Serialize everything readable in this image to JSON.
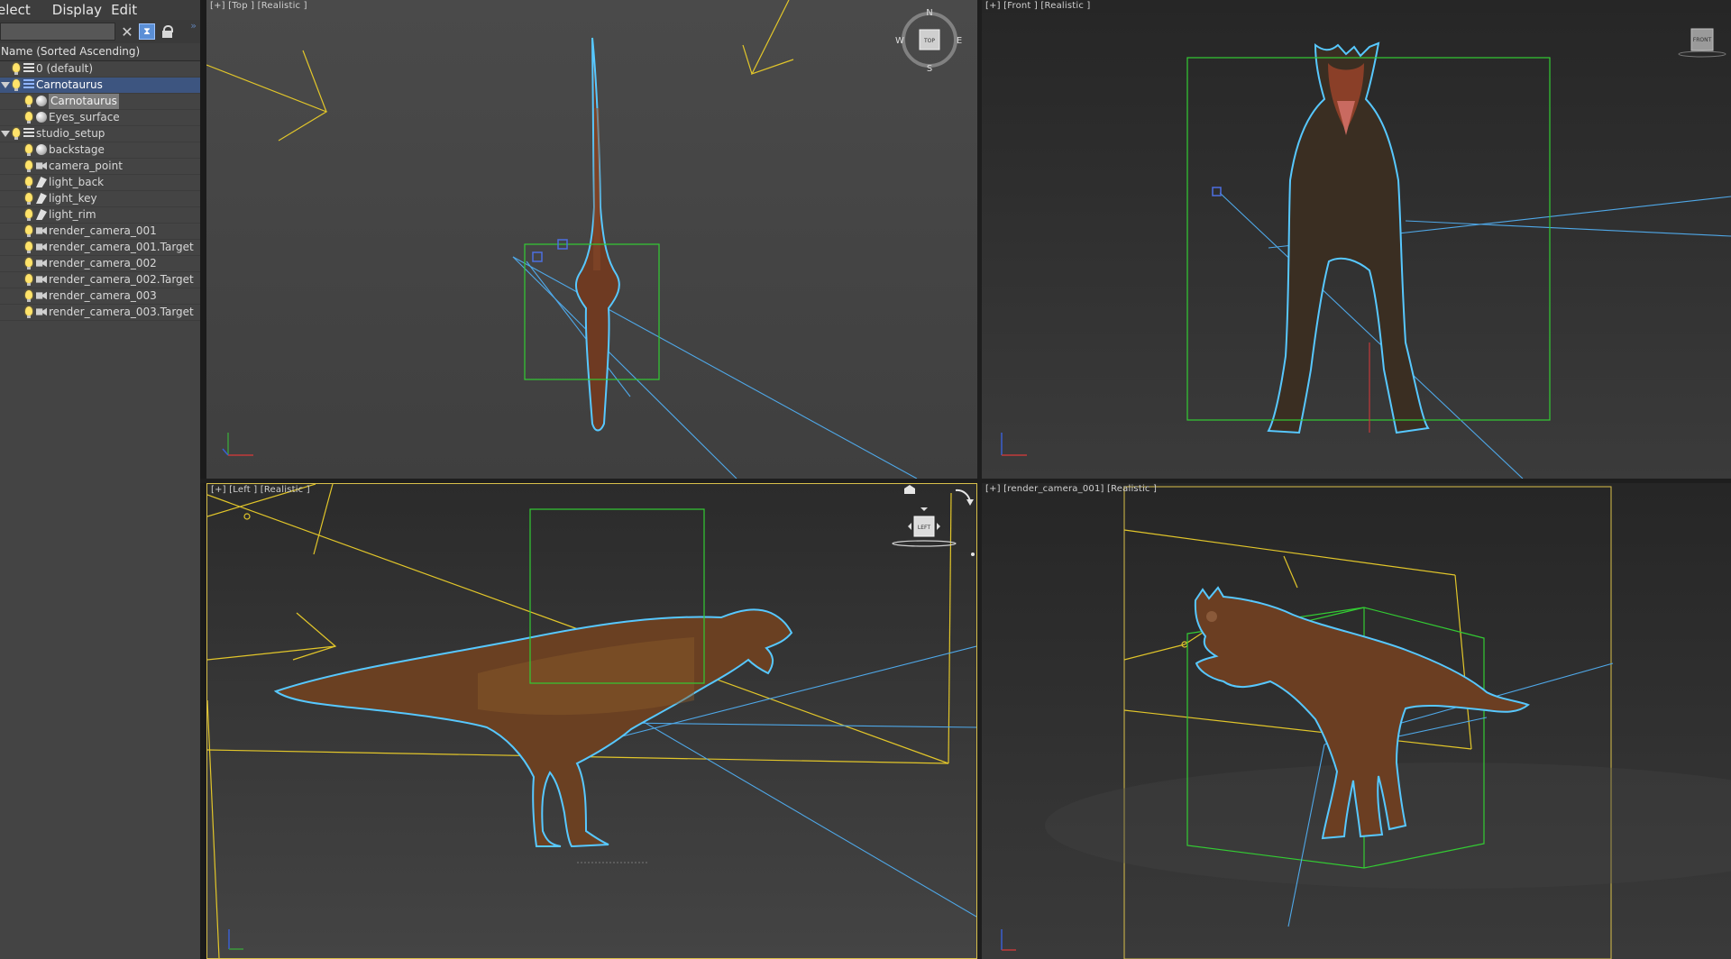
{
  "menu": {
    "select": "elect",
    "display": "Display",
    "edit": "Edit"
  },
  "explorer": {
    "filter_placeholder": "",
    "column_header": "Name (Sorted Ascending)",
    "rows": [
      {
        "label": "0 (default)",
        "depth": 1,
        "icon": "layer-icon"
      },
      {
        "label": "Carnotaurus",
        "depth": 1,
        "icon": "layer-icon"
      },
      {
        "label": "Carnotaurus",
        "depth": 2,
        "icon": "sphere-icon"
      },
      {
        "label": "Eyes_surface",
        "depth": 2,
        "icon": "sphere-icon"
      },
      {
        "label": "studio_setup",
        "depth": 1,
        "icon": "layer-icon"
      },
      {
        "label": "backstage",
        "depth": 2,
        "icon": "sphere-icon"
      },
      {
        "label": "camera_point",
        "depth": 2,
        "icon": "camera-icon"
      },
      {
        "label": "light_back",
        "depth": 2,
        "icon": "light-icon"
      },
      {
        "label": "light_key",
        "depth": 2,
        "icon": "light-icon"
      },
      {
        "label": "light_rim",
        "depth": 2,
        "icon": "light-icon"
      },
      {
        "label": "render_camera_001",
        "depth": 2,
        "icon": "camera-icon"
      },
      {
        "label": "render_camera_001.Target",
        "depth": 2,
        "icon": "camera-icon"
      },
      {
        "label": "render_camera_002",
        "depth": 2,
        "icon": "camera-icon"
      },
      {
        "label": "render_camera_002.Target",
        "depth": 2,
        "icon": "camera-icon"
      },
      {
        "label": "render_camera_003",
        "depth": 2,
        "icon": "camera-icon"
      },
      {
        "label": "render_camera_003.Target",
        "depth": 2,
        "icon": "camera-icon"
      }
    ]
  },
  "viewports": {
    "top": {
      "label": "[+] [Top ] [Realistic ]",
      "cube": "TOP",
      "compass": {
        "n": "N",
        "s": "S",
        "e": "E",
        "w": "W"
      }
    },
    "front": {
      "label": "[+] [Front ] [Realistic ]",
      "cube": "FRONT"
    },
    "left": {
      "label": "[+] [Left ] [Realistic ]",
      "cube": "LEFT"
    },
    "camera": {
      "label": "[+] [render_camera_001] [Realistic ]"
    }
  },
  "colors": {
    "selection_outline": "#4fc3f7",
    "bbox": "#33cc33",
    "camera": "#e2c62a",
    "layer_selected": "#3d5580"
  }
}
